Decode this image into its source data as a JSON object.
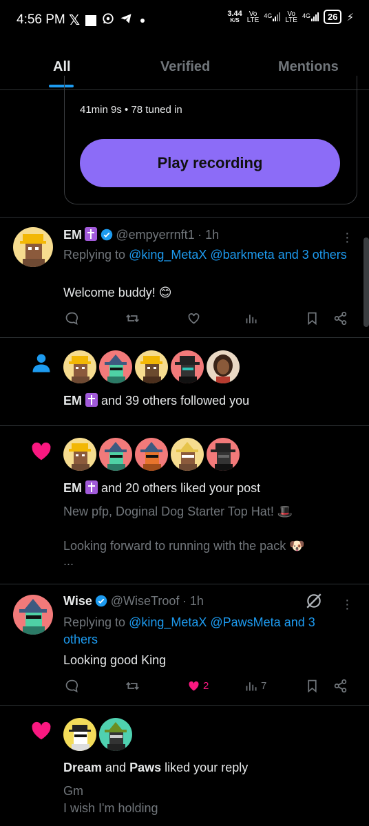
{
  "status_bar": {
    "time": "4:56 PM",
    "net_speed": "3.44",
    "net_unit": "K/S",
    "sig1_top": "Vo",
    "sig1_bottom": "LTE",
    "sig1_gen": "4G",
    "sig2_top": "Vo",
    "sig2_bottom": "LTE",
    "sig2_gen": "4G",
    "battery": "26"
  },
  "tabs": [
    {
      "label": "All",
      "active": true
    },
    {
      "label": "Verified",
      "active": false
    },
    {
      "label": "Mentions",
      "active": false
    }
  ],
  "space": {
    "meta": "41min 9s • 78 tuned in",
    "play_label": "Play recording"
  },
  "tweet1": {
    "name": "EM",
    "handle": "@empyerrnft1",
    "time": "· 1h",
    "replying_prefix": "Replying to ",
    "replying_users": "@king_MetaX @barkmeta and 3 others",
    "text": "Welcome buddy! 😊",
    "likes": "",
    "views": ""
  },
  "follow_notif": {
    "name": "EM",
    "text": "and 39 others followed you"
  },
  "like_notif": {
    "name": "EM",
    "text": "and 20 others liked your post",
    "post_line1": "New pfp, Doginal Dog Starter Top Hat!  🎩",
    "post_line2": "Looking forward to running with the pack  🐶",
    "post_more": "..."
  },
  "tweet2": {
    "name": "Wise",
    "handle": "@WiseTroof",
    "time": "· 1h",
    "replying_prefix": "Replying to ",
    "replying_users": "@king_MetaX @PawsMeta and 3 others",
    "text": "Looking good King",
    "likes": "2",
    "views": "7"
  },
  "reply_like_notif": {
    "name1": "Dream",
    "joiner": "and",
    "name2": "Paws",
    "text": "liked your reply",
    "reply_line1": "Gm",
    "reply_line2": "I wish I'm holding"
  },
  "colors": {
    "accent": "#1d9bf0",
    "like": "#f91880",
    "play_button": "#8c6cf7",
    "background": "#000000"
  },
  "icons": [
    "x-icon",
    "gallery-icon",
    "whatsapp-icon",
    "telegram-icon",
    "person-icon",
    "heart-icon",
    "verified-icon",
    "reply-icon",
    "retweet-icon",
    "views-icon",
    "bookmark-icon",
    "share-icon",
    "grok-icon",
    "more-icon"
  ]
}
